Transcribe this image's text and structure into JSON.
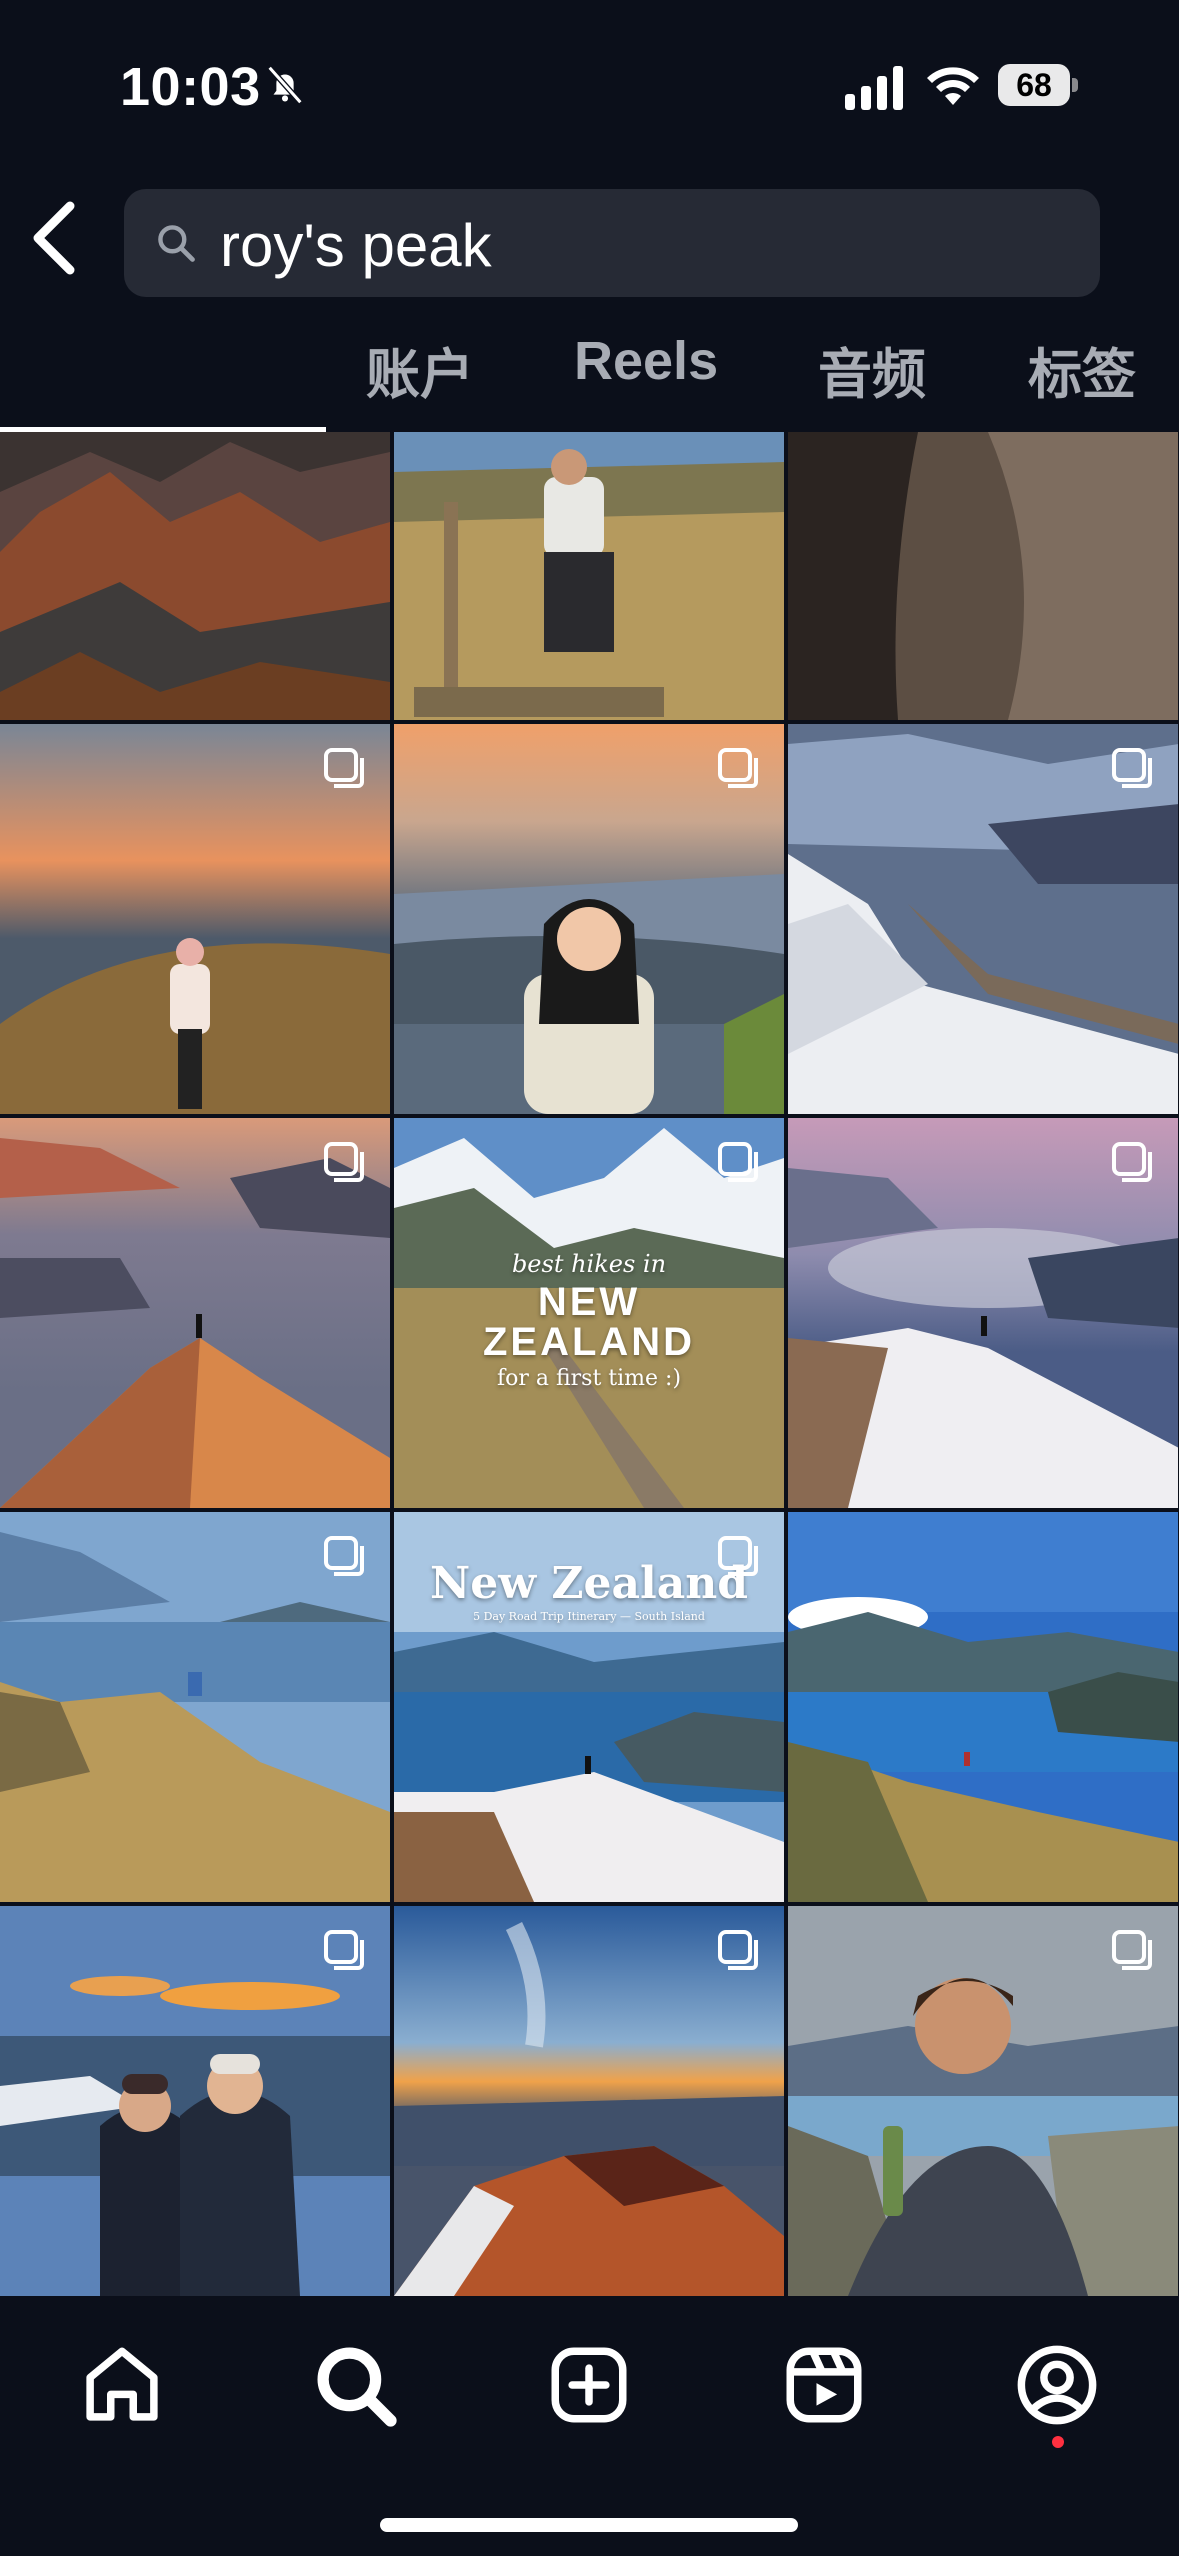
{
  "status_bar": {
    "time": "10:03",
    "battery": "68"
  },
  "search": {
    "query": "roy's peak"
  },
  "tabs": [
    "账户",
    "Reels",
    "音频",
    "标签"
  ],
  "overlays": {
    "nz_title_small": "best hikes in",
    "nz_title_big_1": "NEW",
    "nz_title_big_2": "ZEALAND",
    "nz_title_sub": "for a first time :)",
    "nz_roadtrip_title": "New Zealand",
    "nz_roadtrip_sub": "5 Day Road Trip Itinerary — South Island"
  },
  "nav": [
    "home-icon",
    "search-icon",
    "create-icon",
    "reels-icon",
    "profile-icon"
  ],
  "colors": {
    "background": "#0b0f1a",
    "notification_dot": "#ff3040"
  }
}
